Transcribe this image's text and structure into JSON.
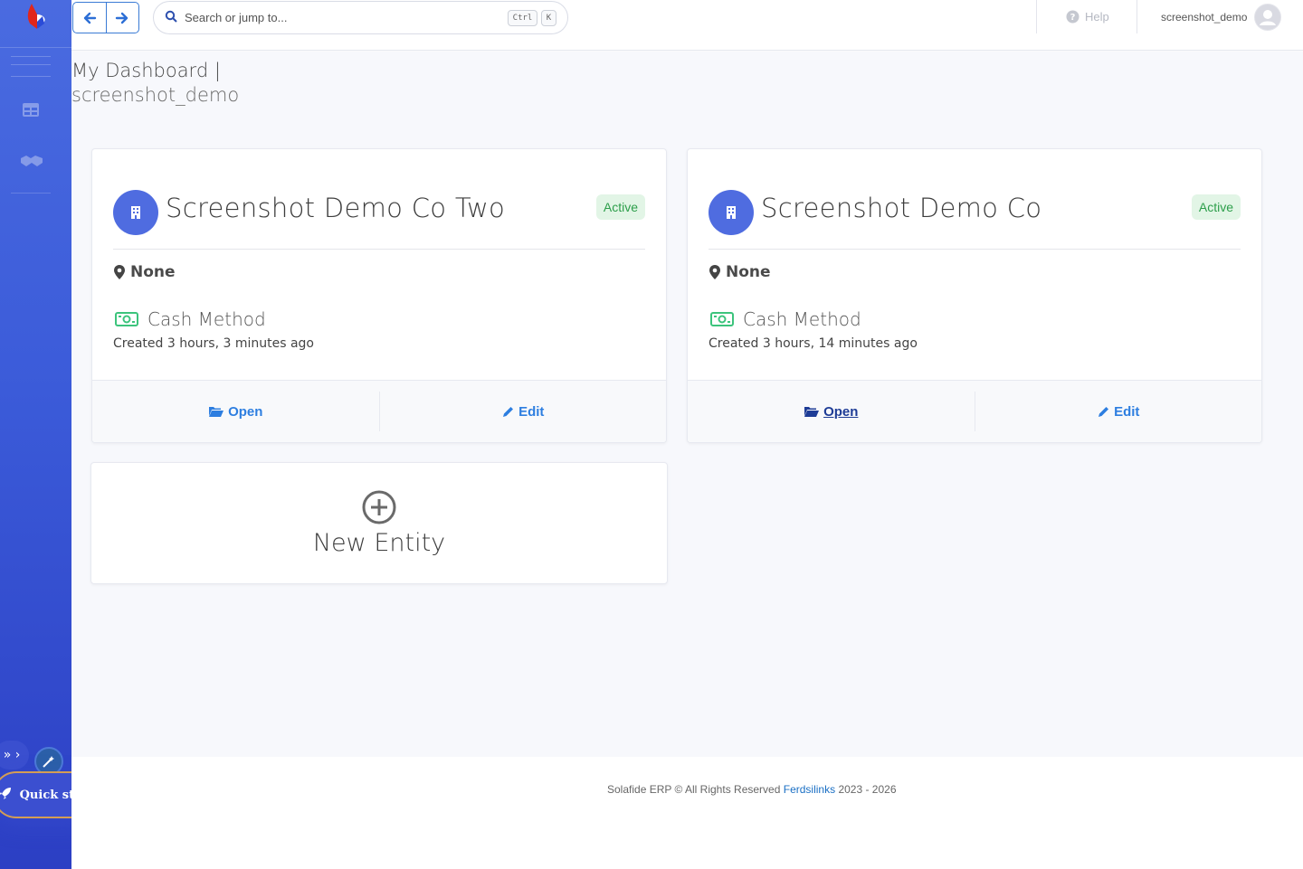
{
  "topbar": {
    "search_placeholder": "Search or jump to...",
    "shortcut_ctrl": "Ctrl",
    "shortcut_k": "K",
    "help_label": "Help",
    "username": "screenshot_demo"
  },
  "page": {
    "title": "My Dashboard |",
    "subtitle": "screenshot_demo"
  },
  "entities": [
    {
      "name": "Screenshot Demo Co Two",
      "status": "Active",
      "location": "None",
      "accounting_method": "Cash Method",
      "created": "Created 3 hours, 3 minutes ago",
      "open_label": "Open",
      "edit_label": "Edit"
    },
    {
      "name": "Screenshot Demo Co",
      "status": "Active",
      "location": "None",
      "accounting_method": "Cash Method",
      "created": "Created 3 hours, 14 minutes ago",
      "open_label": "Open",
      "edit_label": "Edit"
    }
  ],
  "new_entity": {
    "label": "New Entity"
  },
  "sidebar": {
    "quick_start": "Quick start"
  },
  "footer": {
    "prefix": "Solafide ERP © All Rights Reserved",
    "link": "Ferdsilinks",
    "years": "2023 - 2026"
  },
  "colors": {
    "sidebar_top": "#4a6be0",
    "sidebar_bottom": "#2c3fc4",
    "accent": "#2d7ee0",
    "badge_bg": "#e2f5e6",
    "badge_text": "#2c9e4a",
    "avatar_bg": "#4f6ce0",
    "money_icon": "#3cc47c"
  }
}
